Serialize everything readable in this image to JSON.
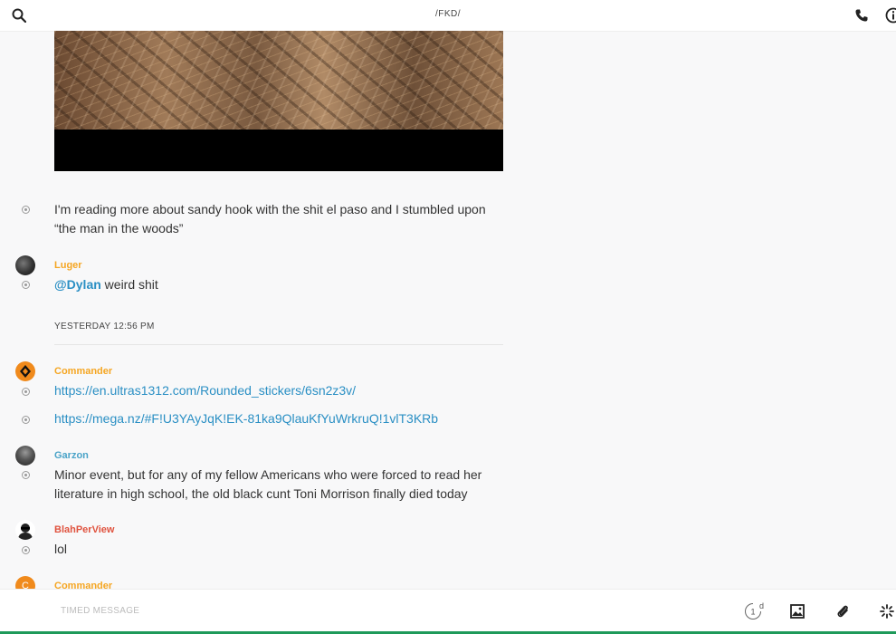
{
  "header": {
    "title": "/FKD/"
  },
  "messages": {
    "m1": {
      "text": "I'm reading more about sandy hook with the shit el paso and I stumbled upon “the man in the woods”"
    },
    "luger": {
      "author": "Luger",
      "mention": "@Dylan",
      "text": " weird shit"
    },
    "commander": {
      "author": "Commander",
      "link1": "https://en.ultras1312.com/Rounded_stickers/6sn2z3v/",
      "link2": "https://mega.nz/#F!U3YAyJqK!EK-81ka9QlauKfYuWrkruQ!1vlT3KRb"
    },
    "garzon": {
      "author": "Garzon",
      "text": "Minor event, but for any of my fellow Americans who were forced to read her literature in high school, the old black cunt Toni Morrison finally died today"
    },
    "blah": {
      "author": "BlahPerView",
      "text": "lol"
    },
    "commander2": {
      "author": "Commander",
      "avatar_letter": "C"
    }
  },
  "divider": {
    "label": "YESTERDAY 12:56 PM"
  },
  "composer": {
    "placeholder": "TIMED MESSAGE",
    "timer_value": "1",
    "timer_unit": "d"
  },
  "colors": {
    "luger": "#f5a623",
    "commander": "#f5a623",
    "garzon": "#4aa3c8",
    "blah": "#e0533f",
    "link": "#2a8fc4",
    "accent_bottom": "#1e9a5a"
  }
}
